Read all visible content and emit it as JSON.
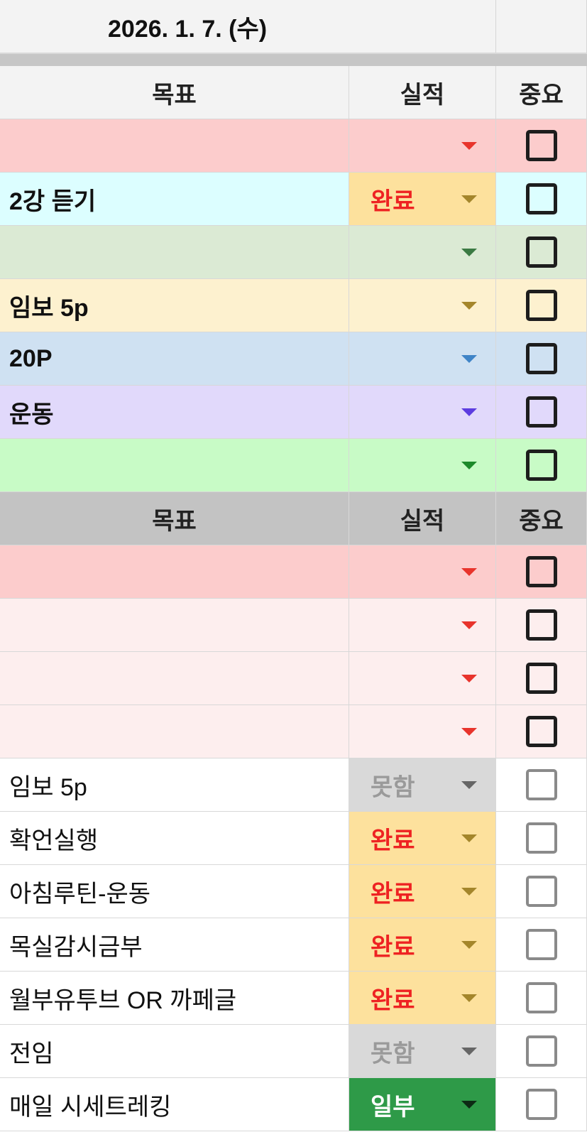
{
  "date_label": "2026. 1. 7. (수)",
  "section1": {
    "headers": {
      "goal": "목표",
      "result": "실적",
      "important": "중요"
    },
    "rows": [
      {
        "goal": "",
        "result": "",
        "row_color": "#fccccc",
        "arrow_color": "#e8342c",
        "important": false
      },
      {
        "goal": "2강 듣기",
        "result": "완료",
        "row_color": "#dcfeff",
        "result_bg": "#fde19d",
        "result_color": "#ee2222",
        "arrow_color": "#a4862b",
        "important": false
      },
      {
        "goal": "",
        "result": "",
        "row_color": "#dbead4",
        "arrow_color": "#3b7a43",
        "important": false
      },
      {
        "goal": "임보 5p",
        "result": "",
        "row_color": "#fdf1cf",
        "arrow_color": "#a4862b",
        "important": false
      },
      {
        "goal": "20P",
        "result": "",
        "row_color": "#cfe1f2",
        "arrow_color": "#3f84c7",
        "important": false
      },
      {
        "goal": "운동",
        "result": "",
        "row_color": "#e1d9fb",
        "arrow_color": "#5c3ce0",
        "important": false
      },
      {
        "goal": "",
        "result": "",
        "row_color": "#c8fbc6",
        "arrow_color": "#1c8a2a",
        "important": false
      }
    ]
  },
  "section2": {
    "headers": {
      "goal": "목표",
      "result": "실적",
      "important": "중요"
    },
    "rows": [
      {
        "goal": "",
        "result": "",
        "row_color": "#fccccc",
        "arrow_color": "#e8342c",
        "important": false
      },
      {
        "goal": "",
        "result": "",
        "row_color": "#fdeeee",
        "arrow_color": "#e8342c",
        "important": false
      },
      {
        "goal": "",
        "result": "",
        "row_color": "#fdeeee",
        "arrow_color": "#e8342c",
        "important": false
      },
      {
        "goal": "",
        "result": "",
        "row_color": "#fdeeee",
        "arrow_color": "#e8342c",
        "important": false
      }
    ]
  },
  "section3": {
    "rows": [
      {
        "goal": "임보 5p",
        "result": "못함",
        "result_bg": "#d9d9d9",
        "result_color": "#9a9a9a",
        "arrow_color": "#666666",
        "important": false
      },
      {
        "goal": "확언실행",
        "result": "완료",
        "result_bg": "#fde19d",
        "result_color": "#ee2222",
        "arrow_color": "#a4862b",
        "important": false
      },
      {
        "goal": "아침루틴-운동",
        "result": "완료",
        "result_bg": "#fde19d",
        "result_color": "#ee2222",
        "arrow_color": "#a4862b",
        "important": false
      },
      {
        "goal": "목실감시금부",
        "result": "완료",
        "result_bg": "#fde19d",
        "result_color": "#ee2222",
        "arrow_color": "#a4862b",
        "important": false
      },
      {
        "goal": "월부유투브 OR 까페글",
        "result": "완료",
        "result_bg": "#fde19d",
        "result_color": "#ee2222",
        "arrow_color": "#a4862b",
        "important": false
      },
      {
        "goal": "전임",
        "result": "못함",
        "result_bg": "#d9d9d9",
        "result_color": "#9a9a9a",
        "arrow_color": "#666666",
        "important": false
      },
      {
        "goal": "매일 시세트레킹",
        "result": "일부",
        "result_bg": "#2e9a48",
        "result_color": "#ffffff",
        "arrow_color": "#0d2b14",
        "important": false
      }
    ]
  }
}
